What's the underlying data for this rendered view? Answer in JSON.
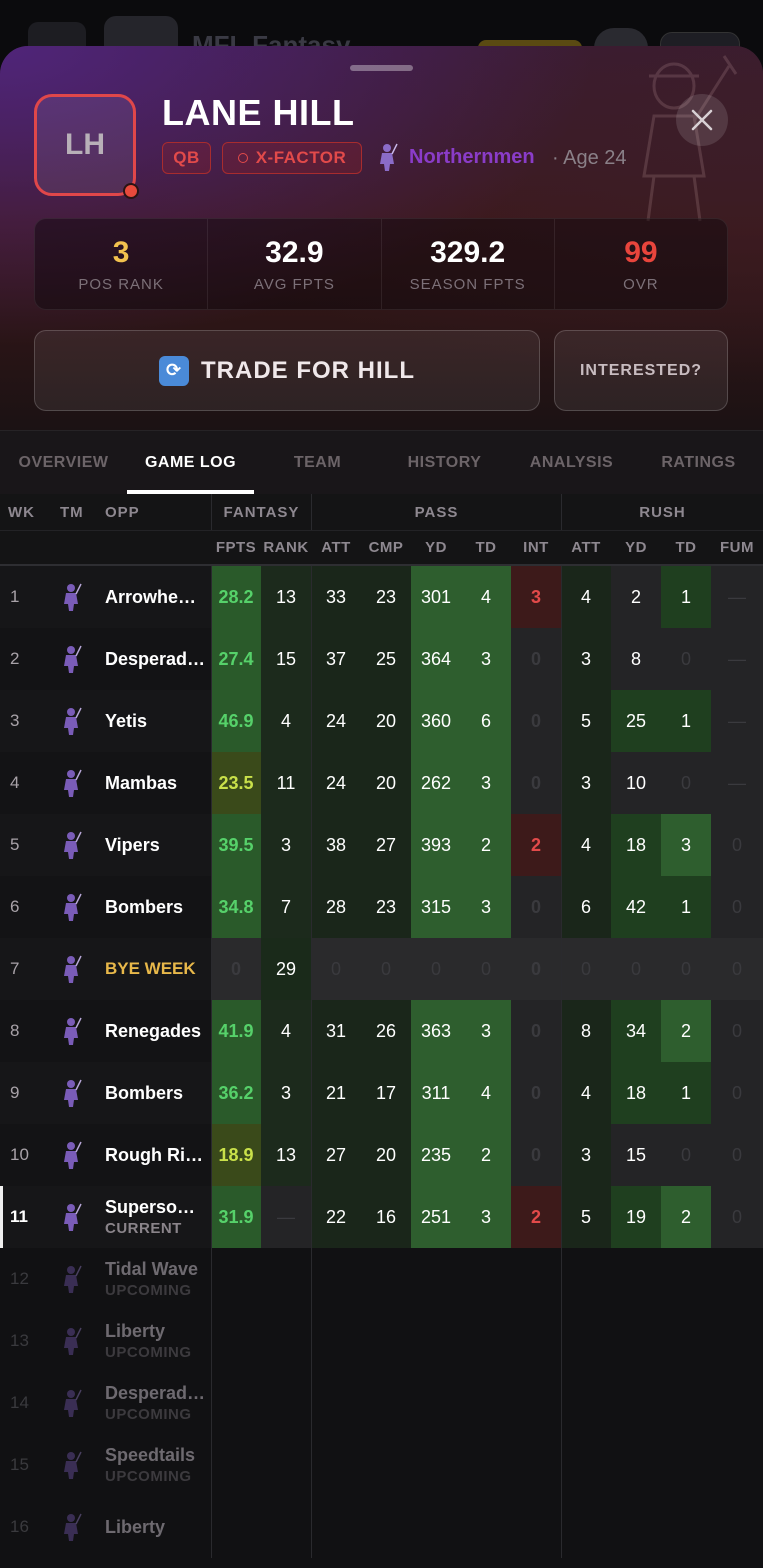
{
  "background_app": {
    "title": "MFL Fantasy"
  },
  "player": {
    "initials": "LH",
    "name": "LANE HILL",
    "position": "QB",
    "tag": "X-FACTOR",
    "team": "Northernmen",
    "age": "· Age 24"
  },
  "stats": [
    {
      "value": "3",
      "label": "POS RANK"
    },
    {
      "value": "32.9",
      "label": "AVG FPTS"
    },
    {
      "value": "329.2",
      "label": "SEASON FPTS"
    },
    {
      "value": "99",
      "label": "OVR"
    }
  ],
  "actions": {
    "trade": "TRADE FOR HILL",
    "interested": "INTERESTED?"
  },
  "tabs": [
    "OVERVIEW",
    "GAME LOG",
    "TEAM",
    "HISTORY",
    "ANALYSIS",
    "RATINGS"
  ],
  "active_tab": "GAME LOG",
  "table": {
    "groups": {
      "wk": "WK",
      "tm": "TM",
      "opp": "OPP",
      "fantasy": "FANTASY",
      "pass": "PASS",
      "rush": "RUSH"
    },
    "columns": [
      "FPTS",
      "RANK",
      "ATT",
      "CMP",
      "YD",
      "TD",
      "INT",
      "ATT",
      "YD",
      "TD",
      "FUM"
    ],
    "rows": [
      {
        "wk": "1",
        "opp": "Arrowhe…",
        "sub": "",
        "fpts": "28.2",
        "rank": "13",
        "p_att": "33",
        "p_cmp": "23",
        "p_yd": "301",
        "p_td": "4",
        "p_int": "3",
        "r_att": "4",
        "r_yd": "2",
        "r_td": "1",
        "fum": "—"
      },
      {
        "wk": "2",
        "opp": "Desperad…",
        "sub": "",
        "fpts": "27.4",
        "rank": "15",
        "p_att": "37",
        "p_cmp": "25",
        "p_yd": "364",
        "p_td": "3",
        "p_int": "0",
        "r_att": "3",
        "r_yd": "8",
        "r_td": "0",
        "fum": "—"
      },
      {
        "wk": "3",
        "opp": "Yetis",
        "sub": "",
        "fpts": "46.9",
        "rank": "4",
        "p_att": "24",
        "p_cmp": "20",
        "p_yd": "360",
        "p_td": "6",
        "p_int": "0",
        "r_att": "5",
        "r_yd": "25",
        "r_td": "1",
        "fum": "—"
      },
      {
        "wk": "4",
        "opp": "Mambas",
        "sub": "",
        "fpts": "23.5",
        "rank": "11",
        "p_att": "24",
        "p_cmp": "20",
        "p_yd": "262",
        "p_td": "3",
        "p_int": "0",
        "r_att": "3",
        "r_yd": "10",
        "r_td": "0",
        "fum": "—"
      },
      {
        "wk": "5",
        "opp": "Vipers",
        "sub": "",
        "fpts": "39.5",
        "rank": "3",
        "p_att": "38",
        "p_cmp": "27",
        "p_yd": "393",
        "p_td": "2",
        "p_int": "2",
        "r_att": "4",
        "r_yd": "18",
        "r_td": "3",
        "fum": "0"
      },
      {
        "wk": "6",
        "opp": "Bombers",
        "sub": "",
        "fpts": "34.8",
        "rank": "7",
        "p_att": "28",
        "p_cmp": "23",
        "p_yd": "315",
        "p_td": "3",
        "p_int": "0",
        "r_att": "6",
        "r_yd": "42",
        "r_td": "1",
        "fum": "0"
      },
      {
        "wk": "7",
        "opp": "BYE WEEK",
        "sub": "",
        "fpts": "0",
        "rank": "29",
        "p_att": "0",
        "p_cmp": "0",
        "p_yd": "0",
        "p_td": "0",
        "p_int": "0",
        "r_att": "0",
        "r_yd": "0",
        "r_td": "0",
        "fum": "0"
      },
      {
        "wk": "8",
        "opp": "Renegades",
        "sub": "",
        "fpts": "41.9",
        "rank": "4",
        "p_att": "31",
        "p_cmp": "26",
        "p_yd": "363",
        "p_td": "3",
        "p_int": "0",
        "r_att": "8",
        "r_yd": "34",
        "r_td": "2",
        "fum": "0"
      },
      {
        "wk": "9",
        "opp": "Bombers",
        "sub": "",
        "fpts": "36.2",
        "rank": "3",
        "p_att": "21",
        "p_cmp": "17",
        "p_yd": "311",
        "p_td": "4",
        "p_int": "0",
        "r_att": "4",
        "r_yd": "18",
        "r_td": "1",
        "fum": "0"
      },
      {
        "wk": "10",
        "opp": "Rough Ri…",
        "sub": "",
        "fpts": "18.9",
        "rank": "13",
        "p_att": "27",
        "p_cmp": "20",
        "p_yd": "235",
        "p_td": "2",
        "p_int": "0",
        "r_att": "3",
        "r_yd": "15",
        "r_td": "0",
        "fum": "0"
      },
      {
        "wk": "11",
        "opp": "Superso…",
        "sub": "CURRENT",
        "fpts": "31.9",
        "rank": "—",
        "p_att": "22",
        "p_cmp": "16",
        "p_yd": "251",
        "p_td": "3",
        "p_int": "2",
        "r_att": "5",
        "r_yd": "19",
        "r_td": "2",
        "fum": "0"
      },
      {
        "wk": "12",
        "opp": "Tidal Wave",
        "sub": "UPCOMING"
      },
      {
        "wk": "13",
        "opp": "Liberty",
        "sub": "UPCOMING"
      },
      {
        "wk": "14",
        "opp": "Desperad…",
        "sub": "UPCOMING"
      },
      {
        "wk": "15",
        "opp": "Speedtails",
        "sub": "UPCOMING"
      },
      {
        "wk": "16",
        "opp": "Liberty",
        "sub": ""
      }
    ]
  },
  "colors": {
    "accent_red": "#e24a4a",
    "team_purple": "#8a3cc8",
    "gold": "#f2c14e",
    "fpts_green": "#56d16a",
    "fpts_yellow": "#c9e04a",
    "cell_green_strong": "#2e5e2e",
    "cell_green_mid": "#1f3f1f",
    "cell_red": "#3d1a1a"
  },
  "icons": {
    "close": "close-icon",
    "trade": "refresh-icon",
    "team_logo": "northernmen-logo-icon"
  }
}
